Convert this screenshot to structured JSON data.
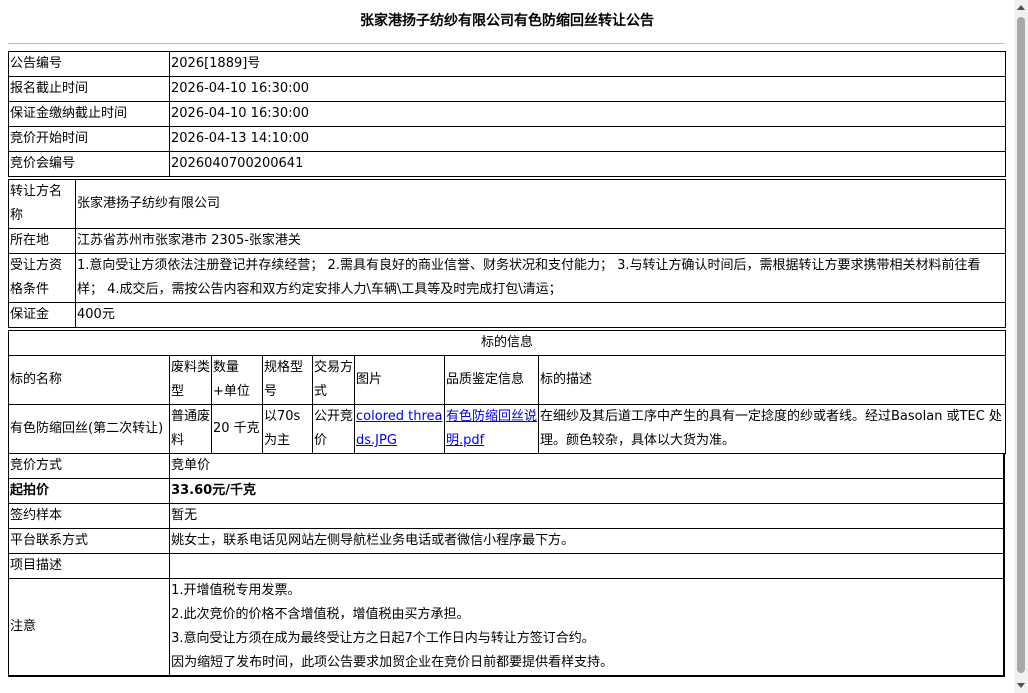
{
  "page": {
    "title": "张家港扬子纺纱有限公司有色防缩回丝转让公告"
  },
  "announcement": {
    "rows": [
      {
        "label": "公告编号",
        "value": "2026[1889]号"
      },
      {
        "label": "报名截止时间",
        "value": "2026-04-10 16:30:00"
      },
      {
        "label": "保证金缴纳截止时间",
        "value": "2026-04-10 16:30:00"
      },
      {
        "label": "竞价开始时间",
        "value": "2026-04-13 14:10:00"
      },
      {
        "label": "竞价会编号",
        "value": "2026040700200641"
      }
    ]
  },
  "transferor": {
    "name_label": "转让方名称",
    "name_value": "张家港扬子纺纱有限公司",
    "location_label": "所在地",
    "location_value": "江苏省苏州市张家港市 2305-张家港关",
    "qualification_label": "受让方资格条件",
    "qualification_value": "1.意向受让方须依法注册登记并存续经营； 2.需具有良好的商业信誉、财务状况和支付能力； 3.与转让方确认时间后，需根据转让方要求携带相关材料前往看样； 4.成交后，需按公告内容和双方约定安排人力\\车辆\\工具等及时完成打包\\清运；",
    "deposit_label": "保证金",
    "deposit_value": "400元"
  },
  "lot": {
    "section_title": "标的信息",
    "headers": {
      "name": "标的名称",
      "type": "废料类型",
      "qty": "数量+单位",
      "spec": "规格型号",
      "trade": "交易方式",
      "image": "图片",
      "quality": "品质鉴定信息",
      "desc": "标的描述"
    },
    "row": {
      "name": "有色防缩回丝(第二次转让)",
      "type": "普通废料",
      "qty": "20 千克",
      "spec": "以70s为主",
      "trade": "公开竞价",
      "image": "colored threads.JPG",
      "quality": "有色防缩回丝说明.pdf",
      "desc": "在细纱及其后道工序中产生的具有一定捻度的纱或者线。经过Basolan 或TEC 处理。颜色较杂，具体以大货为准。"
    }
  },
  "bidding": {
    "method_label": "竞价方式",
    "method_value": "竞单价",
    "start_price_label": "起拍价",
    "start_price_value": "33.60元/千克",
    "sample_label": "签约样本",
    "sample_value": "暂无",
    "contact_label": "平台联系方式",
    "contact_value": "姚女士，联系电话见网站左侧导航栏业务电话或者微信小程序最下方。",
    "project_label": "项目描述",
    "project_value": "",
    "notes_label": "注意",
    "notes": [
      "1.开增值税专用发票。",
      "2.此次竞价的价格不含增值税，增值税由买方承担。",
      "3.意向受让方须在成为最终受让方之日起7个工作日内与转让方签订合约。",
      "因为缩短了发布时间，此项公告要求加贸企业在竞价日前都要提供看样支持。"
    ]
  }
}
